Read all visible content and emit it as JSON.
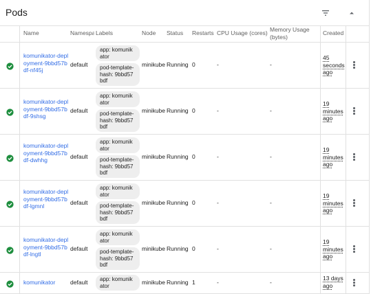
{
  "card": {
    "title": "Pods"
  },
  "columns": {
    "name": "Name",
    "namespace": "Namespace",
    "labels": "Labels",
    "node": "Node",
    "status": "Status",
    "restarts": "Restarts",
    "cpu": "CPU Usage (cores)",
    "memory_line1": "Memory Usage",
    "memory_line2": "(bytes)",
    "created": "Created"
  },
  "colors": {
    "link": "#326de6",
    "status_ok": "#1e8e3e",
    "chip_bg": "#eeeeee",
    "divider": "#e0e0e0"
  },
  "pods": [
    {
      "name": "komunikator-deployment-9bbd57bdf-nf45j",
      "namespace": "default",
      "labels": [
        "app: komunikator",
        "pod-template-hash: 9bbd57bdf"
      ],
      "node": "minikube",
      "status": "Running",
      "restarts": "0",
      "cpu": "-",
      "memory": "-",
      "created": "45 seconds ago"
    },
    {
      "name": "komunikator-deployment-9bbd57bdf-9shsg",
      "namespace": "default",
      "labels": [
        "app: komunikator",
        "pod-template-hash: 9bbd57bdf"
      ],
      "node": "minikube",
      "status": "Running",
      "restarts": "0",
      "cpu": "-",
      "memory": "-",
      "created": "19 minutes ago"
    },
    {
      "name": "komunikator-deployment-9bbd57bdf-dwhhg",
      "namespace": "default",
      "labels": [
        "app: komunikator",
        "pod-template-hash: 9bbd57bdf"
      ],
      "node": "minikube",
      "status": "Running",
      "restarts": "0",
      "cpu": "-",
      "memory": "-",
      "created": "19 minutes ago"
    },
    {
      "name": "komunikator-deployment-9bbd57bdf-lgmnl",
      "namespace": "default",
      "labels": [
        "app: komunikator",
        "pod-template-hash: 9bbd57bdf"
      ],
      "node": "minikube",
      "status": "Running",
      "restarts": "0",
      "cpu": "-",
      "memory": "-",
      "created": "19 minutes ago"
    },
    {
      "name": "komunikator-deployment-9bbd57bdf-lngtl",
      "namespace": "default",
      "labels": [
        "app: komunikator",
        "pod-template-hash: 9bbd57bdf"
      ],
      "node": "minikube",
      "status": "Running",
      "restarts": "0",
      "cpu": "-",
      "memory": "-",
      "created": "19 minutes ago"
    },
    {
      "name": "komunikator",
      "namespace": "default",
      "labels": [
        "app: komunikator"
      ],
      "node": "minikube",
      "status": "Running",
      "restarts": "1",
      "cpu": "-",
      "memory": "-",
      "created": "13 days ago"
    }
  ]
}
